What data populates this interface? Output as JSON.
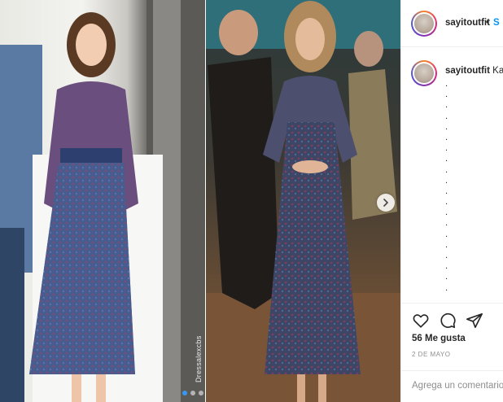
{
  "media": {
    "watermark": "Dressalexcbs",
    "next_icon": "chevron-right-icon",
    "carousel_dots": 3,
    "active_dot": 1
  },
  "post": {
    "username": "sayitoutfit",
    "separator": "•",
    "follow_label": "S",
    "caption": {
      "username": "sayitoutfit",
      "text": "Ka"
    },
    "caption_dot_lines": 20,
    "likes": "56 Me gusta",
    "date": "2 DE MAYO",
    "comment_placeholder": "Agrega un comentario"
  },
  "icons": {
    "like": "heart-icon",
    "comment": "comment-icon",
    "share": "share-icon"
  },
  "colors": {
    "link": "#0095f6",
    "text": "#262626",
    "muted": "#8e8e8e",
    "border": "#efefef",
    "active_dot": "#3897f0"
  }
}
